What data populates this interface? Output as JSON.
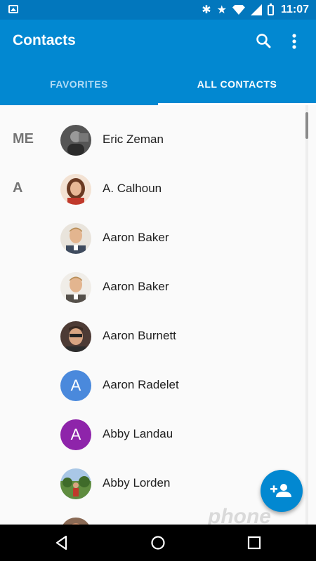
{
  "status_bar": {
    "time": "11:07"
  },
  "app_bar": {
    "title": "Contacts"
  },
  "tabs": [
    {
      "label": "FAVORITES",
      "active": false
    },
    {
      "label": "ALL CONTACTS",
      "active": true
    }
  ],
  "contacts": [
    {
      "section": "ME",
      "name": "Eric Zeman",
      "avatar": "photo"
    },
    {
      "section": "A",
      "name": "A. Calhoun",
      "avatar": "photo"
    },
    {
      "section": "",
      "name": "Aaron Baker",
      "avatar": "photo"
    },
    {
      "section": "",
      "name": "Aaron Baker",
      "avatar": "photo"
    },
    {
      "section": "",
      "name": "Aaron Burnett",
      "avatar": "photo"
    },
    {
      "section": "",
      "name": "Aaron Radelet",
      "avatar": "letter",
      "letter": "A",
      "color": "#4a89dc"
    },
    {
      "section": "",
      "name": "Abby Landau",
      "avatar": "letter",
      "letter": "A",
      "color": "#8e24aa"
    },
    {
      "section": "",
      "name": "Abby Lorden",
      "avatar": "photo"
    }
  ],
  "watermark": "phone scoop",
  "colors": {
    "status_bar": "#0277bd",
    "app_bar": "#0288d1",
    "fab": "#0288d1"
  }
}
